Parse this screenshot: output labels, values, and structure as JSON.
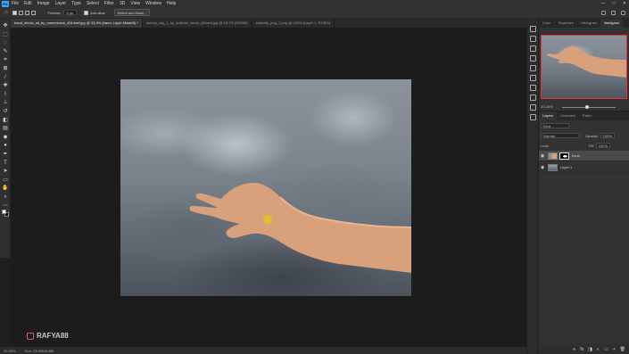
{
  "app": {
    "logo": "Ps",
    "menu": [
      "File",
      "Edit",
      "Image",
      "Layer",
      "Type",
      "Select",
      "Filter",
      "3D",
      "View",
      "Window",
      "Help"
    ],
    "window_controls": [
      "—",
      "□",
      "✕"
    ]
  },
  "options_bar": {
    "feather_label": "Feather:",
    "feather_value": "0 px",
    "antialias_label": "Anti-alias",
    "select_mask_label": "Select and Mask..."
  },
  "document_tabs": [
    {
      "label": "hand_shock_all_by_rosemstock_d51mwf.jpg @ 33.4% (hand, Layer Mask/8) *",
      "active": true
    },
    {
      "label": "stormy_sky_1_by_indleem_stock_d2lvanf.jpg @ 16.7% (RGB/8)",
      "active": false
    },
    {
      "label": "butterfly_png_1.png @ 100% (Layer 1, RGB/8)",
      "active": false
    }
  ],
  "tools": [
    {
      "icon": "move-icon",
      "glyph": "✥"
    },
    {
      "icon": "marquee-icon",
      "glyph": "⬚"
    },
    {
      "icon": "lasso-icon",
      "glyph": "◌"
    },
    {
      "icon": "quick-select-icon",
      "glyph": "✎"
    },
    {
      "icon": "crop-icon",
      "glyph": "⌗"
    },
    {
      "icon": "frame-icon",
      "glyph": "⊠"
    },
    {
      "icon": "eyedropper-icon",
      "glyph": "⁄"
    },
    {
      "icon": "healing-brush-icon",
      "glyph": "✚"
    },
    {
      "icon": "brush-icon",
      "glyph": "⌇"
    },
    {
      "icon": "clone-stamp-icon",
      "glyph": "⊥"
    },
    {
      "icon": "history-brush-icon",
      "glyph": "↺"
    },
    {
      "icon": "eraser-icon",
      "glyph": "◧"
    },
    {
      "icon": "gradient-icon",
      "glyph": "▤"
    },
    {
      "icon": "blur-icon",
      "glyph": "◆"
    },
    {
      "icon": "dodge-icon",
      "glyph": "●"
    },
    {
      "icon": "pen-icon",
      "glyph": "✒"
    },
    {
      "icon": "type-icon",
      "glyph": "T"
    },
    {
      "icon": "path-select-icon",
      "glyph": "➤"
    },
    {
      "icon": "rectangle-icon",
      "glyph": "▭"
    },
    {
      "icon": "hand-icon",
      "glyph": "✋"
    },
    {
      "icon": "zoom-icon",
      "glyph": "⌕"
    },
    {
      "icon": "more-tools-icon",
      "glyph": "⋯"
    }
  ],
  "foreground_color": "#ffffff",
  "background_color": "#000000",
  "status_bar": {
    "zoom": "33.36%",
    "doc_size": "Doc: 23.0M/45.8M"
  },
  "watermark": "RAFYA88",
  "right_panel_icons": [
    "history-icon",
    "actions-icon",
    "adjustments-icon",
    "properties-icon",
    "libraries-icon",
    "paragraph-icon",
    "character-icon",
    "brush-settings-icon",
    "swatches-icon",
    "glyphs-icon"
  ],
  "navigator": {
    "tabs": [
      "Color",
      "Swatches",
      "Histogram",
      "Navigator"
    ],
    "active_tab": "Navigator",
    "zoom": "33.36%",
    "highlight_color": "#e8303a"
  },
  "layers_panel": {
    "tabs": [
      "Layers",
      "Channels",
      "Paths"
    ],
    "active_tab": "Layers",
    "filter_label": "Kind",
    "blend_mode": "Normal",
    "opacity_label": "Opacity:",
    "opacity_value": "100%",
    "lock_label": "Lock:",
    "fill_label": "Fill:",
    "fill_value": "100%",
    "layers": [
      {
        "name": "hand",
        "selected": true,
        "has_mask": true
      },
      {
        "name": "Layer 1",
        "selected": false,
        "has_mask": false
      }
    ],
    "footer_icons": [
      "link-icon",
      "fx-icon",
      "mask-icon",
      "adjustment-icon",
      "group-icon",
      "new-layer-icon",
      "delete-icon"
    ],
    "footer_glyphs": [
      "∞",
      "fx",
      "◨",
      "◐",
      "▭",
      "+",
      "🗑"
    ]
  }
}
